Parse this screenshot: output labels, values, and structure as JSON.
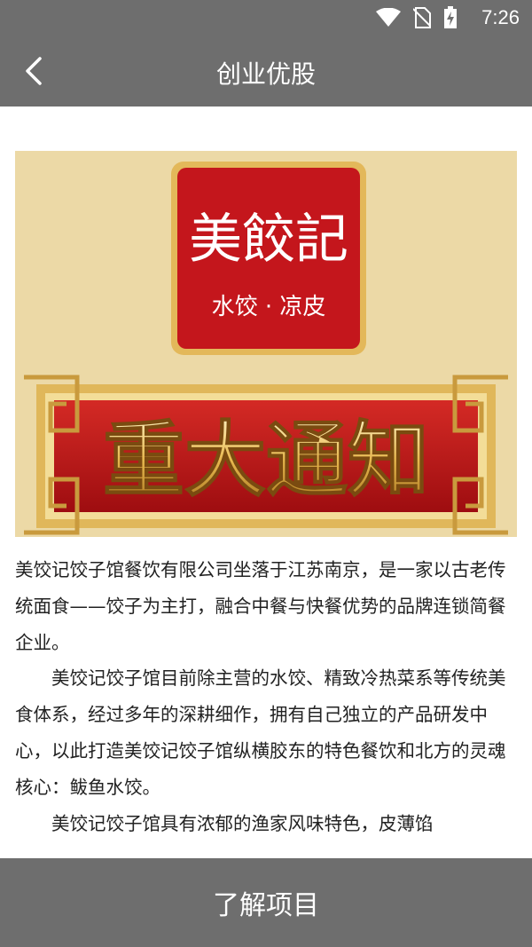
{
  "status_bar": {
    "time": "7:26",
    "icons": [
      "wifi-icon",
      "no-sim-icon",
      "battery-charging-icon"
    ]
  },
  "header": {
    "title": "创业优股",
    "back_icon": "chevron-left-icon"
  },
  "banner": {
    "logo": "美餃記",
    "subtitle": "水饺 · 凉皮",
    "headline": "重大通知"
  },
  "article": {
    "paragraphs": [
      "美饺记饺子馆餐饮有限公司坐落于江苏南京，是一家以古老传统面食——饺子为主打，融合中餐与快餐优势的品牌连锁简餐企业。",
      "美饺记饺子馆目前除主营的水饺、精致冷热菜系等传统美食体系，经过多年的深耕细作，拥有自己独立的产品研发中心，以此打造美饺记饺子馆纵横胶东的特色餐饮和北方的灵魂核心：鲅鱼水饺。",
      "美饺记饺子馆具有浓郁的渔家风味特色，皮薄馅"
    ]
  },
  "footer": {
    "button_label": "了解项目"
  },
  "colors": {
    "bar": "#6e6e6e",
    "banner_bg": "#ecd9a6",
    "red": "#c4161c",
    "gold": "#e0b75a"
  }
}
